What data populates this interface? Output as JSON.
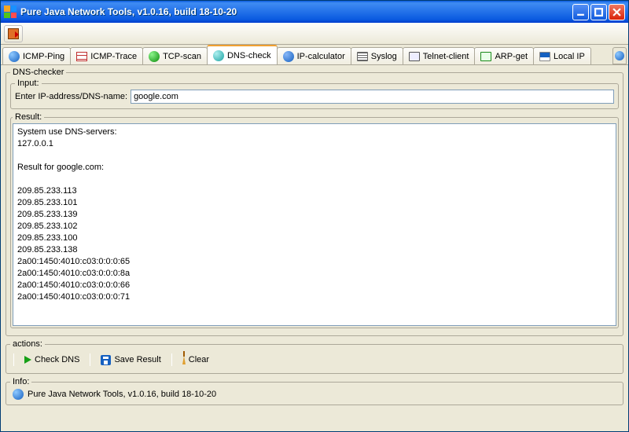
{
  "window": {
    "title": "Pure Java Network Tools,  v1.0.16, build 18-10-20"
  },
  "tabs": [
    {
      "label": "ICMP-Ping"
    },
    {
      "label": "ICMP-Trace"
    },
    {
      "label": "TCP-scan"
    },
    {
      "label": "DNS-check"
    },
    {
      "label": "IP-calculator"
    },
    {
      "label": "Syslog"
    },
    {
      "label": "Telnet-client"
    },
    {
      "label": "ARP-get"
    },
    {
      "label": "Local IP"
    }
  ],
  "panel": {
    "legend": "DNS-checker",
    "input_legend": "Input:",
    "input_label": "Enter IP-address/DNS-name:",
    "input_value": "google.com",
    "result_legend": "Result:",
    "result_text": "System use DNS-servers:\n127.0.0.1\n\nResult for google.com:\n\n209.85.233.113\n209.85.233.101\n209.85.233.139\n209.85.233.102\n209.85.233.100\n209.85.233.138\n2a00:1450:4010:c03:0:0:0:65\n2a00:1450:4010:c03:0:0:0:8a\n2a00:1450:4010:c03:0:0:0:66\n2a00:1450:4010:c03:0:0:0:71"
  },
  "actions": {
    "legend": "actions:",
    "check": "Check DNS",
    "save": "Save Result",
    "clear": "Clear"
  },
  "info": {
    "legend": "Info:",
    "text": "Pure Java Network Tools,  v1.0.16, build 18-10-20"
  }
}
